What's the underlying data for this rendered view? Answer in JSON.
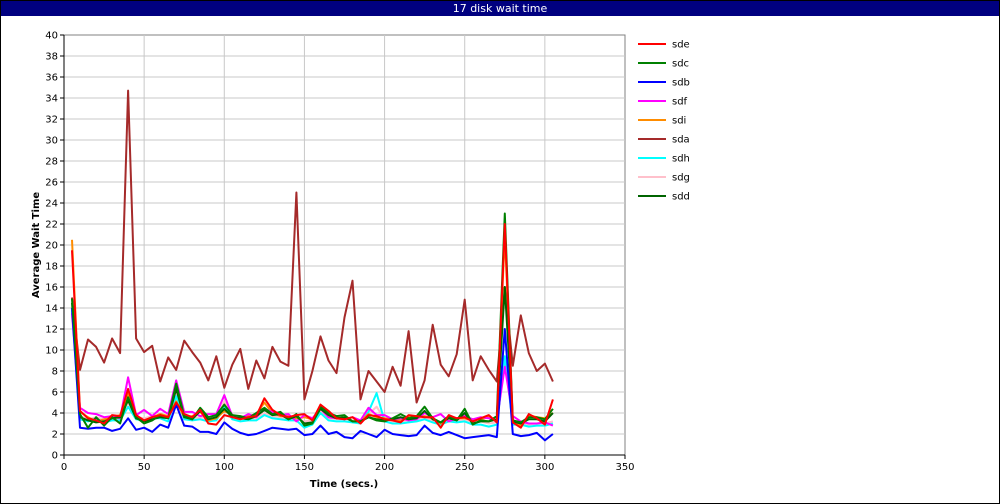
{
  "chart_data": {
    "type": "line",
    "title": "17 disk wait time",
    "xlabel": "Time (secs.)",
    "ylabel": "Average Wait Time",
    "xlim": [
      0,
      350
    ],
    "ylim": [
      0,
      40
    ],
    "xticks": [
      0,
      50,
      100,
      150,
      200,
      250,
      300,
      350
    ],
    "yticks": [
      0,
      2,
      4,
      6,
      8,
      10,
      12,
      14,
      16,
      18,
      20,
      22,
      24,
      26,
      28,
      30,
      32,
      34,
      36,
      38,
      40
    ],
    "grid": true,
    "legend_position": "right",
    "x": [
      5,
      10,
      15,
      20,
      25,
      30,
      35,
      40,
      45,
      50,
      55,
      60,
      65,
      70,
      75,
      80,
      85,
      90,
      95,
      100,
      105,
      110,
      115,
      120,
      125,
      130,
      135,
      140,
      145,
      150,
      155,
      160,
      165,
      170,
      175,
      180,
      185,
      190,
      195,
      200,
      205,
      210,
      215,
      220,
      225,
      230,
      235,
      240,
      245,
      250,
      255,
      260,
      265,
      270,
      275,
      280,
      285,
      290,
      295,
      300,
      305
    ],
    "series": [
      {
        "name": "sde",
        "color": "#ff0000",
        "values": [
          19.5,
          4.2,
          3.5,
          3.3,
          3.0,
          3.8,
          3.7,
          6.3,
          3.8,
          3.3,
          3.6,
          3.8,
          3.6,
          5.0,
          3.9,
          3.6,
          4.3,
          3.0,
          2.9,
          3.8,
          3.6,
          3.4,
          3.6,
          3.7,
          5.4,
          4.3,
          3.8,
          3.6,
          3.8,
          3.9,
          3.3,
          4.8,
          4.2,
          3.5,
          3.4,
          3.6,
          3.0,
          3.8,
          3.7,
          3.4,
          3.3,
          3.1,
          3.8,
          3.7,
          3.6,
          3.6,
          2.6,
          3.8,
          3.5,
          3.6,
          3.2,
          3.5,
          3.8,
          3.1,
          22.0,
          3.1,
          2.6,
          3.9,
          3.5,
          2.9,
          5.3
        ]
      },
      {
        "name": "sdc",
        "color": "#008000",
        "values": [
          14.9,
          3.9,
          2.6,
          3.6,
          2.8,
          3.6,
          3.0,
          5.5,
          3.6,
          3.0,
          3.3,
          3.8,
          3.5,
          6.8,
          3.7,
          3.4,
          4.5,
          3.6,
          3.8,
          4.8,
          3.8,
          3.7,
          3.5,
          4.0,
          4.5,
          3.9,
          4.1,
          3.4,
          3.9,
          2.8,
          3.0,
          4.6,
          4.0,
          3.7,
          3.8,
          3.2,
          3.2,
          3.6,
          3.3,
          3.2,
          3.5,
          3.9,
          3.5,
          3.7,
          4.6,
          3.5,
          3.1,
          3.7,
          3.3,
          4.4,
          2.9,
          3.3,
          3.2,
          3.7,
          23.0,
          3.3,
          3.1,
          3.6,
          3.6,
          3.4,
          4.4
        ]
      },
      {
        "name": "sdb",
        "color": "#0000ff",
        "values": [
          14.0,
          2.6,
          2.5,
          2.6,
          2.6,
          2.3,
          2.5,
          3.5,
          2.4,
          2.6,
          2.2,
          2.9,
          2.6,
          4.8,
          2.8,
          2.7,
          2.2,
          2.2,
          2.0,
          3.1,
          2.5,
          2.1,
          1.9,
          2.0,
          2.3,
          2.6,
          2.5,
          2.4,
          2.5,
          1.9,
          2.0,
          2.8,
          2.0,
          2.2,
          1.7,
          1.6,
          2.3,
          2.0,
          1.7,
          2.4,
          2.0,
          1.9,
          1.8,
          1.9,
          2.8,
          2.1,
          1.9,
          2.2,
          1.9,
          1.6,
          1.7,
          1.8,
          1.9,
          1.7,
          12.0,
          2.0,
          1.8,
          1.9,
          2.1,
          1.4,
          2.0
        ]
      },
      {
        "name": "sdf",
        "color": "#ff00ff",
        "values": [
          13.5,
          4.5,
          4.0,
          3.9,
          3.6,
          3.7,
          3.5,
          7.4,
          3.8,
          4.3,
          3.7,
          4.4,
          3.9,
          7.1,
          4.1,
          4.1,
          3.7,
          3.9,
          3.9,
          5.7,
          3.7,
          3.5,
          3.9,
          3.6,
          4.4,
          4.1,
          3.8,
          3.9,
          3.2,
          3.8,
          3.5,
          4.4,
          3.6,
          3.5,
          3.4,
          3.6,
          3.3,
          4.5,
          3.8,
          3.8,
          3.4,
          3.5,
          3.3,
          3.4,
          4.0,
          3.6,
          3.9,
          3.2,
          3.5,
          3.7,
          3.4,
          3.6,
          3.5,
          3.3,
          8.4,
          3.7,
          3.2,
          3.0,
          3.0,
          3.1,
          2.8
        ]
      },
      {
        "name": "sdi",
        "color": "#ff8c00",
        "values": [
          20.5,
          4.1,
          3.6,
          3.2,
          3.4,
          3.6,
          3.8,
          5.9,
          3.6,
          3.3,
          3.6,
          3.9,
          3.7,
          5.1,
          3.6,
          3.7,
          4.1,
          3.3,
          3.5,
          4.2,
          3.8,
          3.6,
          3.7,
          3.9,
          5.0,
          4.0,
          3.7,
          3.7,
          3.5,
          3.6,
          3.4,
          4.5,
          3.9,
          3.6,
          3.4,
          3.6,
          3.2,
          3.9,
          3.6,
          3.5,
          3.4,
          3.3,
          3.7,
          3.6,
          3.7,
          3.5,
          3.0,
          3.7,
          3.5,
          3.5,
          3.3,
          3.4,
          3.6,
          3.3,
          21.0,
          3.2,
          2.8,
          3.8,
          3.6,
          3.5,
          4.0
        ]
      },
      {
        "name": "sda",
        "color": "#a52a2a",
        "values": [
          15.0,
          8.1,
          11.0,
          10.3,
          8.8,
          11.1,
          9.7,
          34.7,
          11.1,
          9.8,
          10.4,
          7.0,
          9.3,
          8.1,
          10.9,
          9.8,
          8.8,
          7.1,
          9.4,
          6.4,
          8.6,
          10.1,
          6.3,
          9.0,
          7.3,
          10.3,
          8.9,
          8.5,
          25.0,
          5.3,
          8.0,
          11.3,
          9.0,
          7.8,
          13.1,
          16.6,
          5.3,
          8.0,
          7.0,
          6.0,
          8.4,
          6.6,
          11.8,
          5.0,
          7.1,
          12.4,
          8.6,
          7.5,
          9.6,
          14.8,
          7.1,
          9.4,
          8.1,
          7.0,
          16.0,
          8.5,
          13.3,
          9.7,
          8.0,
          8.7,
          7.0
        ]
      },
      {
        "name": "sdh",
        "color": "#00ffff",
        "values": [
          13.8,
          3.4,
          3.2,
          3.5,
          3.1,
          3.3,
          3.3,
          4.6,
          3.4,
          3.3,
          3.5,
          3.5,
          3.2,
          5.6,
          3.4,
          3.3,
          3.4,
          3.2,
          3.3,
          4.6,
          3.4,
          3.2,
          3.3,
          3.3,
          3.8,
          3.5,
          3.4,
          3.3,
          3.3,
          2.6,
          2.9,
          4.0,
          3.3,
          3.2,
          3.2,
          3.1,
          3.0,
          4.1,
          5.9,
          3.2,
          3.0,
          3.0,
          3.1,
          3.2,
          3.4,
          3.1,
          2.9,
          3.2,
          3.1,
          3.2,
          2.9,
          2.9,
          2.7,
          2.9,
          9.4,
          2.9,
          2.9,
          2.7,
          2.8,
          2.8,
          3.0
        ]
      },
      {
        "name": "sdg",
        "color": "#ffc0cb",
        "values": [
          13.2,
          3.7,
          3.4,
          3.6,
          3.4,
          3.5,
          3.4,
          5.0,
          3.6,
          3.5,
          3.7,
          3.7,
          3.5,
          5.8,
          3.6,
          3.5,
          3.6,
          3.5,
          3.5,
          5.1,
          3.6,
          3.4,
          3.5,
          3.5,
          4.0,
          3.7,
          3.6,
          3.5,
          3.5,
          3.2,
          3.3,
          4.1,
          3.5,
          3.4,
          3.4,
          3.3,
          3.2,
          3.9,
          4.6,
          3.4,
          3.2,
          3.2,
          3.3,
          3.3,
          3.6,
          3.3,
          3.1,
          3.4,
          3.3,
          3.4,
          3.1,
          3.2,
          3.0,
          3.1,
          9.0,
          3.1,
          3.0,
          2.9,
          3.0,
          3.0,
          3.2
        ]
      },
      {
        "name": "sdd",
        "color": "#006400",
        "values": [
          14.5,
          3.6,
          3.3,
          3.1,
          3.2,
          3.5,
          3.6,
          5.2,
          3.5,
          3.2,
          3.4,
          3.6,
          3.5,
          6.3,
          3.6,
          3.4,
          4.2,
          3.4,
          3.6,
          4.4,
          3.6,
          3.5,
          3.4,
          3.7,
          4.3,
          3.8,
          3.9,
          3.4,
          3.7,
          3.0,
          3.1,
          4.4,
          3.8,
          3.5,
          3.6,
          3.2,
          3.2,
          3.6,
          3.4,
          3.3,
          3.4,
          3.6,
          3.4,
          3.5,
          4.2,
          3.4,
          3.1,
          3.5,
          3.3,
          4.0,
          3.0,
          3.2,
          3.2,
          3.4,
          16.0,
          3.2,
          3.0,
          3.4,
          3.4,
          3.2,
          4.0
        ]
      }
    ]
  }
}
